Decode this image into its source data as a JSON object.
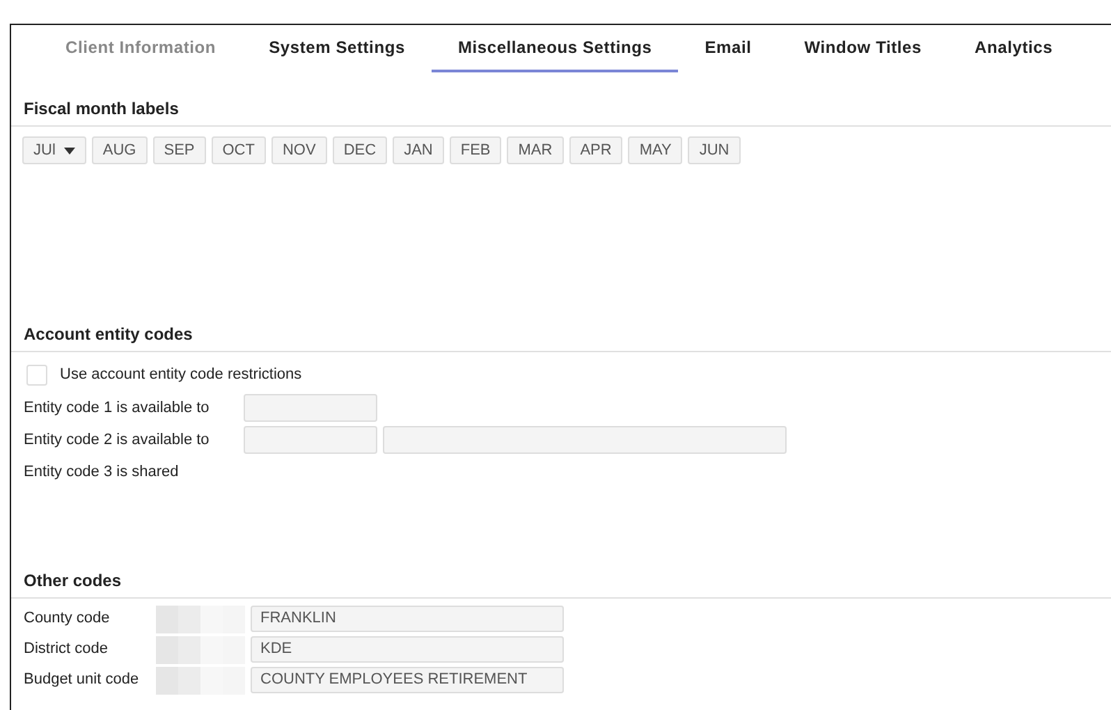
{
  "tabs": [
    {
      "label": "Client Information",
      "selected": false,
      "disabled": true
    },
    {
      "label": "System Settings",
      "selected": false,
      "disabled": false
    },
    {
      "label": "Miscellaneous Settings",
      "selected": true,
      "disabled": false
    },
    {
      "label": "Email",
      "selected": false,
      "disabled": false
    },
    {
      "label": "Window Titles",
      "selected": false,
      "disabled": false
    },
    {
      "label": "Analytics",
      "selected": false,
      "disabled": false
    }
  ],
  "fiscal_month_labels": {
    "title": "Fiscal month labels",
    "first_month": "JUl",
    "months": [
      "AUG",
      "SEP",
      "OCT",
      "NOV",
      "DEC",
      "JAN",
      "FEB",
      "MAR",
      "APR",
      "MAY",
      "JUN"
    ]
  },
  "account_entity_codes": {
    "title": "Account entity codes",
    "restriction": {
      "label": "Use account entity code restrictions",
      "checked": false
    },
    "rows": [
      {
        "label": "Entity code 1 is available to",
        "kind": "single"
      },
      {
        "label": "Entity code 2 is available to",
        "kind": "double"
      },
      {
        "label": "Entity code 3 is shared",
        "kind": "plain"
      }
    ]
  },
  "other_codes": {
    "title": "Other codes",
    "rows": [
      {
        "label": "County code",
        "value": "FRANKLIN"
      },
      {
        "label": "District code",
        "value": "KDE"
      },
      {
        "label": "Budget unit code",
        "value": "COUNTY EMPLOYEES RETIREMENT"
      }
    ]
  }
}
